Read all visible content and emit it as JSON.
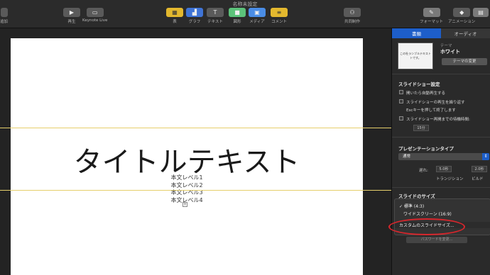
{
  "window": {
    "title": "名称未設定"
  },
  "toolbar": {
    "add": "追加",
    "play": "再生",
    "keynote_live": "Keynote Live",
    "table": "表",
    "chart": "グラフ",
    "text": "テキスト",
    "shape": "図形",
    "media": "メディア",
    "comment": "コメント",
    "collaborate": "共同制作",
    "format": "フォーマット",
    "animate": "アニメーション",
    "document": "書類"
  },
  "slide": {
    "title": "タイトルテキスト",
    "body": [
      "本文レベル1",
      "本文レベル2",
      "本文レベル3",
      "本文レベル4"
    ]
  },
  "inspector": {
    "tabs": [
      "書類",
      "オーディオ"
    ],
    "theme": {
      "thumb_text": "この社ランブルテキスト\nトです。",
      "label": "テーマ",
      "name": "ホワイト",
      "change_button": "テーマの変更"
    },
    "slideshow": {
      "title": "スライドショー設定",
      "autoplay": "開いたら自動再生する",
      "loop": "スライドショーの再生を繰り返す",
      "esc_note": "Escキーを押して終了します",
      "restart": "スライドショー再開までの待機時間:",
      "restart_value": "15分"
    },
    "presentation": {
      "title": "プレゼンテーションタイプ",
      "selected": "通常",
      "delay_label": "遅れ:",
      "transition_value": "5.0秒",
      "build_value": "2.0秒",
      "transition": "トランジション",
      "build": "ビルド"
    },
    "slide_size": {
      "title": "スライドのサイズ",
      "options": [
        "✓ 標準 (4:3)",
        "ワイドスクリーン (16:9)",
        "カスタムのスライドサイズ..."
      ],
      "password_button": "パスワードを変更..."
    }
  },
  "colors": {
    "accent": "#1d5ec9",
    "highlight_circle": "#d7262c",
    "guide": "#e6cf6b"
  }
}
